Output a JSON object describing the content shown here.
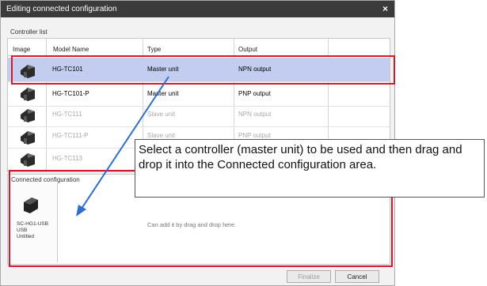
{
  "dialog": {
    "title": "Editing connected configuration",
    "close_icon": "×"
  },
  "controller_list": {
    "label": "Controller list",
    "columns": [
      "Image",
      "Model Name",
      "Type",
      "Output"
    ],
    "rows": [
      {
        "model": "HG-TC101",
        "type": "Master unit",
        "output": "NPN output",
        "state": "selected"
      },
      {
        "model": "HG-TC101-P",
        "type": "Master unit",
        "output": "PNP output",
        "state": "normal"
      },
      {
        "model": "HG-TC111",
        "type": "Slave unit",
        "output": "NPN output",
        "state": "disabled"
      },
      {
        "model": "HG-TC111-P",
        "type": "Slave unit",
        "output": "PNP output",
        "state": "disabled"
      },
      {
        "model": "HG-TC113",
        "type": "",
        "output": "",
        "state": "disabled"
      }
    ]
  },
  "connected": {
    "label": "Connected configuration",
    "device": {
      "line1": "SC-HG1-USB",
      "line2": "USB",
      "line3": "Untitled"
    },
    "hint": "Can add it by drag and drop here."
  },
  "buttons": {
    "finalize": "Finalize",
    "cancel": "Cancel"
  },
  "callout": {
    "text": "Select a controller (master unit) to be used and then drag and drop it into the  Connected configuration  area."
  },
  "colors": {
    "highlight": "#d7172a",
    "arrow": "#2d6fd1",
    "selection": "#c3cdf0"
  },
  "icons": {
    "controller": "controller-device-icon",
    "usb": "usb-device-icon"
  }
}
